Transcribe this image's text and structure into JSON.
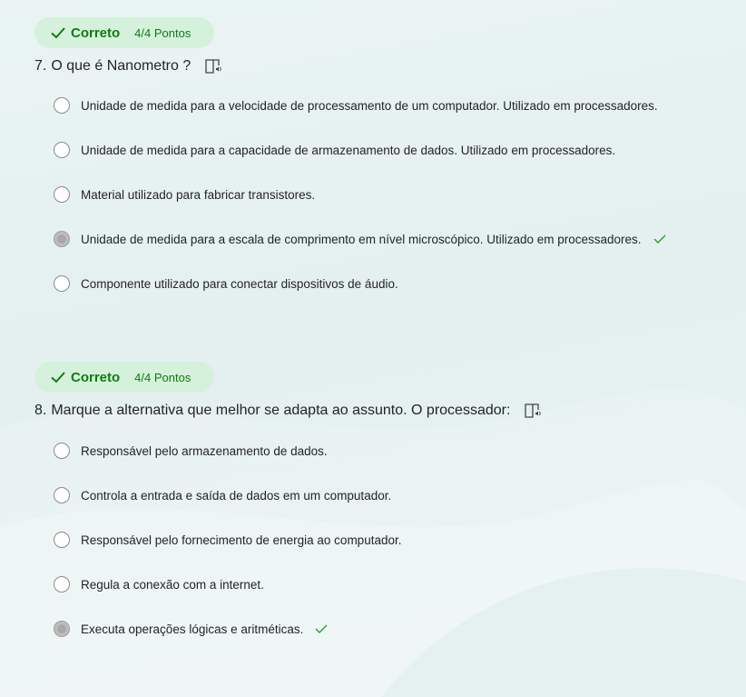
{
  "questions": [
    {
      "status": "Correto",
      "points": "4/4 Pontos",
      "number": "7.",
      "title": "O que é Nanometro ?",
      "options": [
        {
          "label": "Unidade de medida para a velocidade de processamento de um computador. Utilizado em processadores.",
          "selected": false,
          "correct": false
        },
        {
          "label": "Unidade de medida para a capacidade de armazenamento de dados. Utilizado em processadores.",
          "selected": false,
          "correct": false
        },
        {
          "label": "Material utilizado para fabricar transistores.",
          "selected": false,
          "correct": false
        },
        {
          "label": "Unidade de medida para a escala de comprimento em nível microscópico. Utilizado em processadores.",
          "selected": true,
          "correct": true
        },
        {
          "label": "Componente utilizado para conectar dispositivos de áudio.",
          "selected": false,
          "correct": false
        }
      ]
    },
    {
      "status": "Correto",
      "points": "4/4 Pontos",
      "number": "8.",
      "title": "Marque a alternativa que melhor se adapta ao assunto. O processador:",
      "options": [
        {
          "label": "Responsável pelo armazenamento de dados.",
          "selected": false,
          "correct": false
        },
        {
          "label": "Controla a entrada e saída de dados em um computador.",
          "selected": false,
          "correct": false
        },
        {
          "label": "Responsável pelo fornecimento de energia ao computador.",
          "selected": false,
          "correct": false
        },
        {
          "label": "Regula a conexão com a internet.",
          "selected": false,
          "correct": false
        },
        {
          "label": "Executa operações lógicas e aritméticas.",
          "selected": true,
          "correct": true
        }
      ]
    }
  ],
  "icons": {
    "status": "check-icon",
    "reader": "immersive-reader-icon",
    "correct": "check-icon"
  },
  "colors": {
    "correct_green": "#107c10",
    "badge_bg": "#d5f1dc",
    "selected_radio": "#bdbdbd"
  }
}
